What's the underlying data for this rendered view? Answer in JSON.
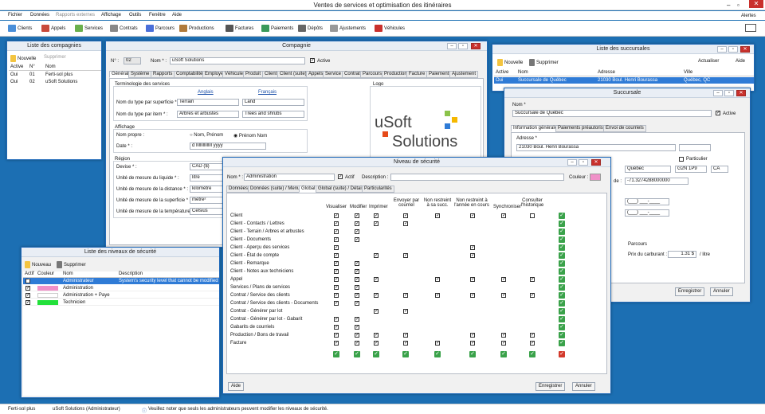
{
  "app": {
    "title": "Ventes de services et optimisation des itinéraires",
    "alerts": "Alertes"
  },
  "menu": [
    "Fichier",
    "Données",
    "Rapports externes",
    "Affichage",
    "Outils",
    "Fenêtre",
    "Aide"
  ],
  "toolbar": [
    "Clients",
    "Appels",
    "Services",
    "Contrats",
    "Parcours",
    "Productions",
    "Factures",
    "Paiements",
    "Dépôts",
    "Ajustements",
    "Véhicules"
  ],
  "companies": {
    "title": "Liste des compagnies",
    "new": "Nouvelle",
    "delete": "Supprimer",
    "cols": [
      "Active",
      "N°",
      "Nom"
    ],
    "rows": [
      [
        "Oui",
        "01",
        "Ferti-sol plus"
      ],
      [
        "Oui",
        "02",
        "uSoft Solutions"
      ]
    ]
  },
  "company": {
    "title": "Compagnie",
    "num_label": "N° :",
    "num": "02",
    "name_label": "Nom * :",
    "name": "uSoft Solutions",
    "active": "Active",
    "tabs": [
      "Général",
      "Système",
      "Rapports",
      "Comptabilité",
      "Employé",
      "Véhicule",
      "Produit",
      "Client",
      "Client (suite)",
      "Appels",
      "Service",
      "Contrat",
      "Parcours",
      "Production",
      "Facture",
      "Paiement",
      "Ajustement"
    ],
    "term": "Terminologie des services",
    "en": "Anglais",
    "fr": "Français",
    "surf_label": "Nom du type par superficie * :",
    "surf_en": "Terrain",
    "surf_fr": "Land",
    "item_label": "Nom du type par item * :",
    "item_en": "Arbres et arbustes",
    "item_fr": "Trees and shrubs",
    "disp": "Affichage",
    "proper_label": "Nom propre :",
    "opt1": "Nom, Prénom",
    "opt2": "Prénom Nom",
    "date_label": "Date * :",
    "date": "d MMMM yyyy",
    "region": "Région",
    "cur_label": "Devise * :",
    "cur": "CAD ($)",
    "liq_label": "Unité de mesure du liquide * :",
    "liq": "litre",
    "dist_label": "Unité de mesure de la distance * :",
    "dist": "kilomètre",
    "area_label": "Unité de mesure de la superficie * :",
    "area": "mètre²",
    "temp_label": "Unité de mesure de la température * :",
    "temp": "Celsius",
    "logo": "Logo",
    "logo_a": "uSoft",
    "logo_b": "Solutions"
  },
  "branches": {
    "title": "Liste des succursales",
    "new": "Nouvelle",
    "delete": "Supprimer",
    "refresh": "Actualiser",
    "help": "Aide",
    "cols": [
      "Active",
      "Nom",
      "Adresse",
      "Ville"
    ],
    "row": [
      "Oui",
      "Succursale de Québec",
      "21030 Boul. Henri Bourassa",
      "Québec, QC"
    ]
  },
  "branch": {
    "title": "Succursale",
    "name_label": "Nom *",
    "name": "Succursale de Québec",
    "active": "Active",
    "tabs": [
      "Information générale",
      "Paiements préautorisés",
      "Envoi de courriels"
    ],
    "addr_label": "Adresse *",
    "addr": "21030 Boul. Henri Bourassa",
    "particulier": "Particulier",
    "prov": "Québec",
    "postal": "G2N 1P9",
    "country": "CA",
    "coord_label": "de :",
    "coord": "-71.3274288000000",
    "phone1": "(___) ___-____",
    "phone2": "(___) ___-____",
    "route": "Parcours",
    "fuel_label": "Prix du carburant :",
    "fuel": "1.31 $",
    "fuel_unit": "/ litre",
    "save": "Enregistrer",
    "cancel": "Annuler"
  },
  "security": {
    "title": "Niveau de sécurité",
    "name_label": "Nom * :",
    "name": "Administration",
    "active": "Actif",
    "desc_label": "Description :",
    "color_label": "Couleur :",
    "color": "#f090c8",
    "tabs": [
      "Données",
      "Données (suite) / Menu",
      "Global",
      "Global (suite) / Détails",
      "Particularités"
    ],
    "cols": [
      "Visualiser",
      "Modifier",
      "Imprimer",
      "Envoyer par courriel",
      "Non restreint à sa succ.",
      "Non restreint à l'année en cours",
      "Synchroniser",
      "Consulter l'historique"
    ],
    "rows": [
      "Client",
      "Client - Contacts / Lettres",
      "Client - Terrain / Arbres et arbustes",
      "Client - Documents",
      "Client - Aperçu des services",
      "Client - État de compte",
      "Client - Remarque",
      "Client - Notes aux techniciens",
      "Appel",
      "Services / Plans de services",
      "Contrat / Service des clients",
      "Contrat / Service des clients - Documents",
      "Contrat - Générer par lot",
      "Contrat - Générer par lot - Gabarit",
      "Gabarits de courriels",
      "Production / Bons de travail",
      "Facture"
    ],
    "help": "Aide",
    "save": "Enregistrer",
    "cancel": "Annuler"
  },
  "levels": {
    "title": "Liste des niveaux de sécurité",
    "new": "Nouveau",
    "delete": "Supprimer",
    "cols": [
      "Actif",
      "Couleur",
      "Nom",
      "Description"
    ],
    "rows": [
      {
        "name": "Administrateur",
        "desc": "System's security level that cannot be modified / Nive",
        "color": "#2f7bd6"
      },
      {
        "name": "Administration",
        "desc": "",
        "color": "#f090c8"
      },
      {
        "name": "Administration + Paye",
        "desc": "",
        "color": "#ffffff"
      },
      {
        "name": "Technicien",
        "desc": "",
        "color": "#22e03a"
      }
    ]
  },
  "status": {
    "db": "Ferti-sol plus",
    "user": "uSoft Solutions (Administrateur)",
    "msg": "Veuillez noter que seuls les administrateurs peuvent modifier les niveaux de sécurité."
  }
}
